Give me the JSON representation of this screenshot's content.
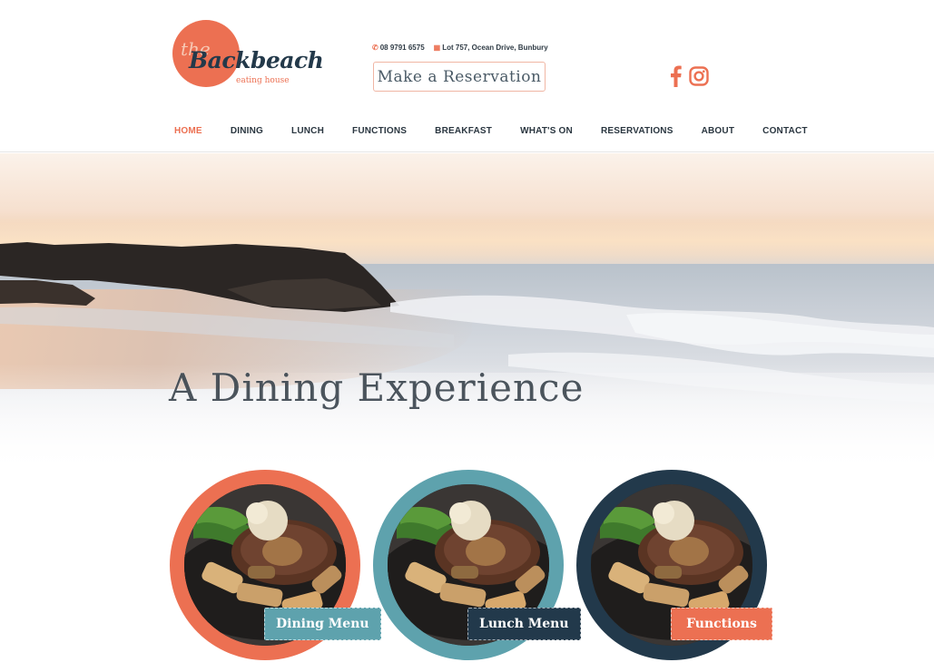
{
  "colors": {
    "accent": "#ec7052",
    "teal": "#5ea2ad",
    "navy": "#22394b",
    "text": "#2a3640"
  },
  "logo": {
    "the": "the",
    "name": "Backbeach",
    "tagline": "eating house"
  },
  "contact": {
    "phone_icon": "phone-icon",
    "phone": "08 9791 6575",
    "map_icon": "map-icon",
    "address": "Lot 757, Ocean Drive, Bunbury"
  },
  "header": {
    "reserve_label": "Make a Reservation"
  },
  "social": [
    {
      "icon": "facebook-icon"
    },
    {
      "icon": "instagram-icon"
    }
  ],
  "nav": [
    {
      "label": "HOME",
      "active": true
    },
    {
      "label": "DINING"
    },
    {
      "label": "LUNCH"
    },
    {
      "label": "FUNCTIONS"
    },
    {
      "label": "BREAKFAST"
    },
    {
      "label": "WHAT'S ON"
    },
    {
      "label": "RESERVATIONS"
    },
    {
      "label": "ABOUT"
    },
    {
      "label": "CONTACT"
    }
  ],
  "hero": {
    "title": "A Dining Experience"
  },
  "cards": [
    {
      "label": "Dining Menu",
      "ring_color": "#ec7052",
      "button_color": "#5ea2ad"
    },
    {
      "label": "Lunch Menu",
      "ring_color": "#5ea2ad",
      "button_color": "#22394b"
    },
    {
      "label": "Functions",
      "ring_color": "#22394b",
      "button_color": "#ec7052"
    }
  ]
}
